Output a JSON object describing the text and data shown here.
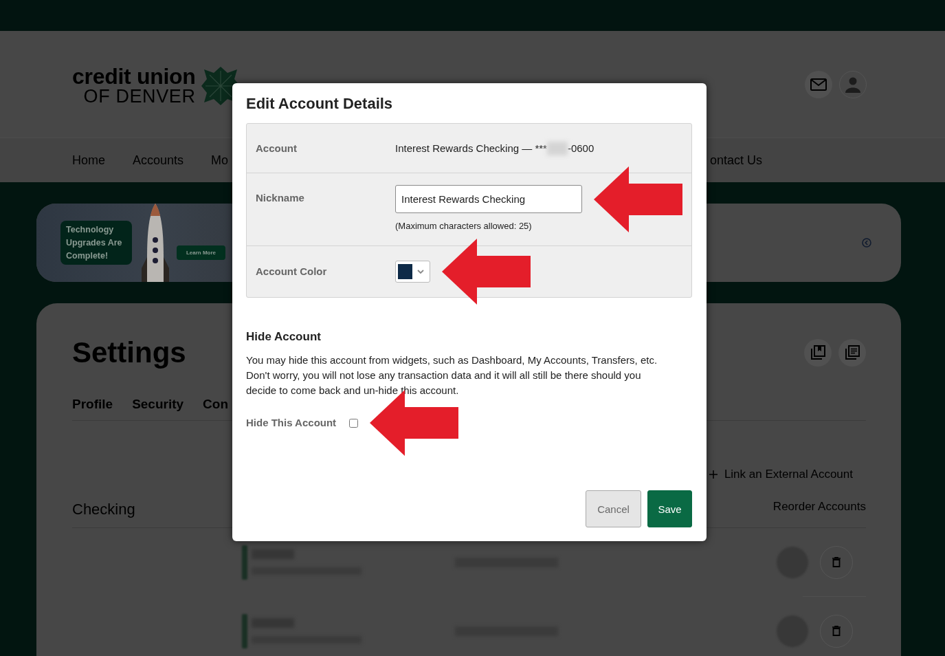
{
  "header": {
    "logo": {
      "line_1": "credit union",
      "line_2": "OF DENVER"
    },
    "nav": [
      {
        "label": "Home"
      },
      {
        "label": "Accounts"
      },
      {
        "label": "Mo"
      },
      {
        "label": "ontact Us"
      }
    ]
  },
  "banner": {
    "headline": "Technology Upgrades Are Complete!",
    "button": "Learn More"
  },
  "settings": {
    "title": "Settings",
    "tabs": [
      {
        "label": "Profile",
        "selected": false
      },
      {
        "label": "Security",
        "selected": false
      },
      {
        "label": "Con",
        "selected": false
      }
    ],
    "section_title": "Checking",
    "actions": [
      {
        "kind": "add",
        "label": "Link an External Account"
      },
      {
        "kind": "plain",
        "label": "Reorder Accounts"
      }
    ]
  },
  "modal": {
    "title": "Edit Account Details",
    "fields": [
      {
        "kind": "readonly",
        "label": "Account",
        "value": "Interest Rewards Checking — ***",
        "value_end": "-0600"
      },
      {
        "kind": "text_input",
        "label": "Nickname",
        "value": "Interest Rewards Checking",
        "hint": "(Maximum characters allowed: 25)",
        "annotated": true
      },
      {
        "kind": "color_select",
        "label": "Account Color",
        "color": "#0e2a47",
        "annotated": true
      }
    ],
    "hide_section": {
      "title": "Hide Account",
      "text": "You may hide this account from widgets, such as Dashboard, My Accounts, Transfers, etc. Don't worry, you will not lose any transaction data and it will all still be there should you decide to come back and un-hide this account.",
      "checkbox": {
        "label": "Hide This Account",
        "checked": false,
        "annotated": true
      }
    },
    "buttons": [
      {
        "kind": "secondary",
        "label": "Cancel"
      },
      {
        "kind": "primary",
        "label": "Save"
      }
    ]
  }
}
